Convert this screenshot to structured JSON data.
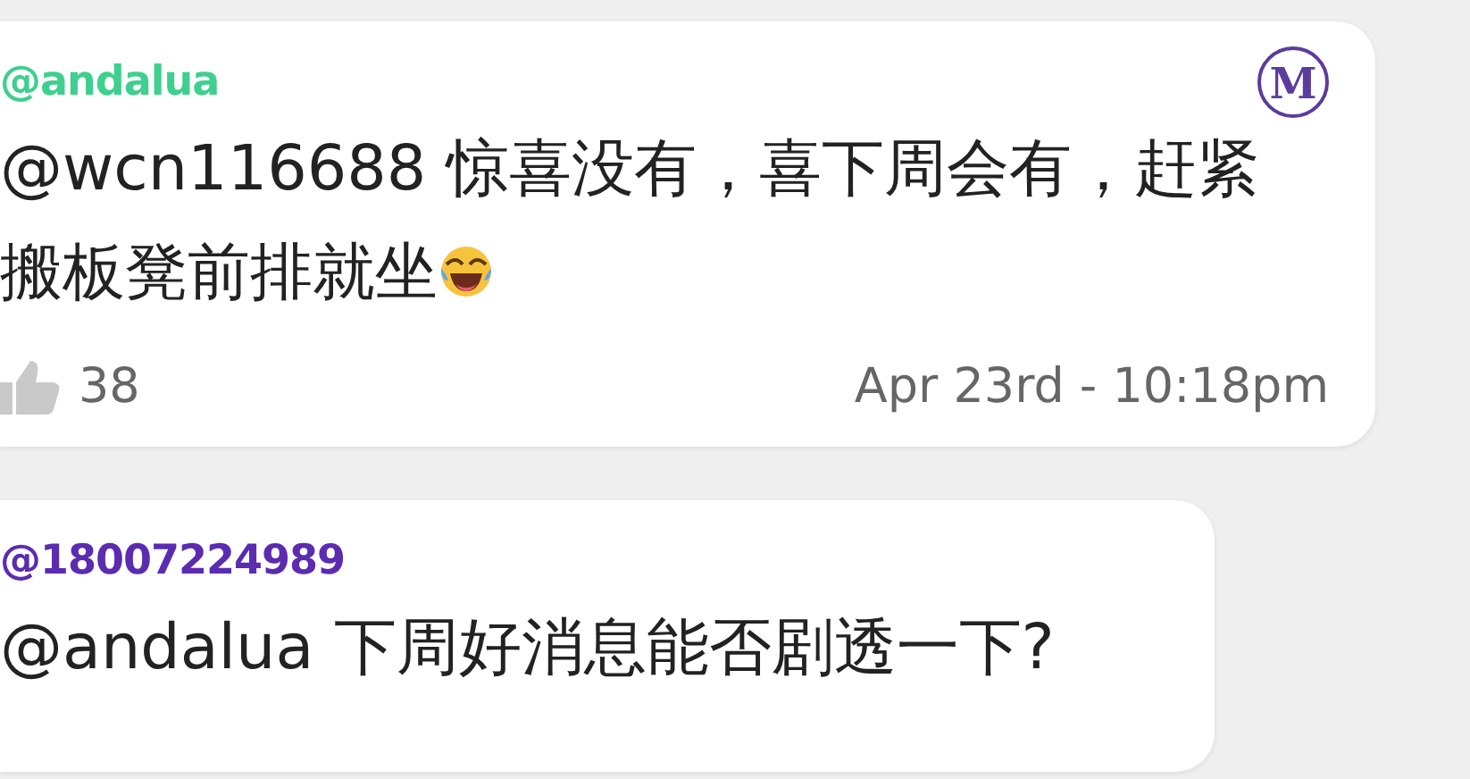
{
  "comments": [
    {
      "author": "@andalua",
      "color": "#3fcf8e",
      "moderator_badge": "M",
      "text": "@wcn116688 惊喜没有，喜下周会有，赶紧搬板凳前排就坐",
      "emoji": true,
      "likes": "38",
      "time": "Apr 23rd - 10:18pm"
    },
    {
      "author": "@18007224989",
      "color": "#5b2bb0",
      "text": "@andalua 下周好消息能否剧透一下?",
      "emoji": false
    }
  ]
}
